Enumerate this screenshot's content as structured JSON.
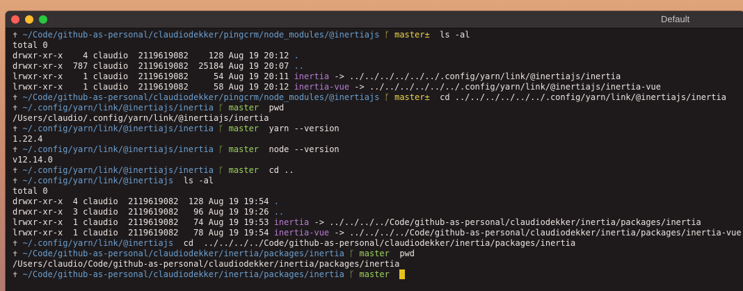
{
  "window": {
    "title": "Default"
  },
  "terminal": {
    "lines": [
      {
        "kind": "prompt",
        "arrow": "✝",
        "path": "~/Code/github-as-personal/claudiodekker/pingcrm/node_modules/@inertiajs",
        "vcs": "ᚴ",
        "branch": "master±",
        "dirty": true,
        "cmd": "  ls -al"
      },
      {
        "kind": "text",
        "text": "total 0"
      },
      {
        "kind": "ls",
        "info": "drwxr-xr-x    4 claudio  2119619082    128 Aug 19 20:12 ",
        "name": ".",
        "link": false
      },
      {
        "kind": "ls",
        "info": "drwxr-xr-x  787 claudio  2119619082  25184 Aug 19 20:07 ",
        "name": "..",
        "link": false
      },
      {
        "kind": "ls",
        "info": "lrwxr-xr-x    1 claudio  2119619082     54 Aug 19 20:11 ",
        "name": "inertia",
        "link": true,
        "target": " -> ../../../../../../.config/yarn/link/@inertiajs/inertia"
      },
      {
        "kind": "ls",
        "info": "lrwxr-xr-x    1 claudio  2119619082     58 Aug 19 20:12 ",
        "name": "inertia-vue",
        "link": true,
        "target": " -> ../../../../../../.config/yarn/link/@inertiajs/inertia-vue"
      },
      {
        "kind": "prompt",
        "arrow": "✝",
        "path": "~/Code/github-as-personal/claudiodekker/pingcrm/node_modules/@inertiajs",
        "vcs": "ᚴ",
        "branch": "master±",
        "dirty": true,
        "cmd": "  cd ../../../../../../.config/yarn/link/@inertiajs/inertia"
      },
      {
        "kind": "prompt",
        "arrow": "✝",
        "path": "~/.config/yarn/link/@inertiajs/inertia",
        "vcs": "ᚴ",
        "branch": "master",
        "dirty": false,
        "cmd": "  pwd"
      },
      {
        "kind": "text",
        "text": "/Users/claudio/.config/yarn/link/@inertiajs/inertia"
      },
      {
        "kind": "prompt",
        "arrow": "✝",
        "path": "~/.config/yarn/link/@inertiajs/inertia",
        "vcs": "ᚴ",
        "branch": "master",
        "dirty": false,
        "cmd": "  yarn --version"
      },
      {
        "kind": "text",
        "text": "1.22.4"
      },
      {
        "kind": "prompt",
        "arrow": "✝",
        "path": "~/.config/yarn/link/@inertiajs/inertia",
        "vcs": "ᚴ",
        "branch": "master",
        "dirty": false,
        "cmd": "  node --version"
      },
      {
        "kind": "text",
        "text": "v12.14.0"
      },
      {
        "kind": "prompt",
        "arrow": "✝",
        "path": "~/.config/yarn/link/@inertiajs/inertia",
        "vcs": "ᚴ",
        "branch": "master",
        "dirty": false,
        "cmd": "  cd .."
      },
      {
        "kind": "prompt",
        "arrow": "✝",
        "path": "~/.config/yarn/link/@inertiajs",
        "vcs": "",
        "branch": "",
        "dirty": false,
        "cmd": "  ls -al"
      },
      {
        "kind": "text",
        "text": "total 0"
      },
      {
        "kind": "ls",
        "info": "drwxr-xr-x  4 claudio  2119619082  128 Aug 19 19:54 ",
        "name": ".",
        "link": false
      },
      {
        "kind": "ls",
        "info": "drwxr-xr-x  3 claudio  2119619082   96 Aug 19 19:26 ",
        "name": "..",
        "link": false
      },
      {
        "kind": "ls",
        "info": "lrwxr-xr-x  1 claudio  2119619082   74 Aug 19 19:53 ",
        "name": "inertia",
        "link": true,
        "target": " -> ../../../../Code/github-as-personal/claudiodekker/inertia/packages/inertia"
      },
      {
        "kind": "ls",
        "info": "lrwxr-xr-x  1 claudio  2119619082   78 Aug 19 19:54 ",
        "name": "inertia-vue",
        "link": true,
        "target": " -> ../../../../Code/github-as-personal/claudiodekker/inertia/packages/inertia-vue"
      },
      {
        "kind": "prompt",
        "arrow": "✝",
        "path": "~/.config/yarn/link/@inertiajs",
        "vcs": "",
        "branch": "",
        "dirty": false,
        "cmd": "  cd  ../../../../Code/github-as-personal/claudiodekker/inertia/packages/inertia"
      },
      {
        "kind": "prompt",
        "arrow": "✝",
        "path": "~/Code/github-as-personal/claudiodekker/inertia/packages/inertia",
        "vcs": "ᚴ",
        "branch": "master",
        "dirty": false,
        "cmd": "  pwd"
      },
      {
        "kind": "text",
        "text": "/Users/claudio/Code/github-as-personal/claudiodekker/inertia/packages/inertia"
      },
      {
        "kind": "prompt",
        "arrow": "✝",
        "path": "~/Code/github-as-personal/claudiodekker/inertia/packages/inertia",
        "vcs": "ᚴ",
        "branch": "master",
        "dirty": false,
        "cmd": "",
        "cursor": true
      }
    ]
  },
  "colors": {
    "path": "#6c9fce",
    "branch_dirty": "#e8d24a",
    "branch_clean": "#9bd25a",
    "symlink": "#b67ccf",
    "cursor": "#e6c31c",
    "background": "#1e1a1c"
  }
}
